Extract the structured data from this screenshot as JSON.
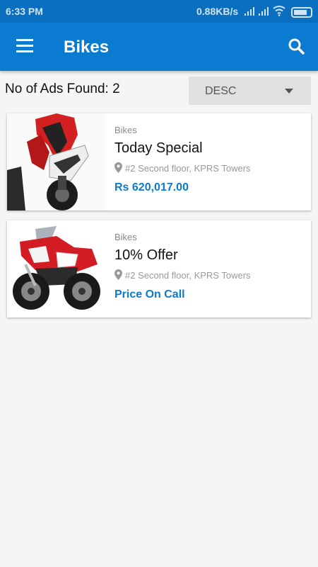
{
  "status_bar": {
    "time": "6:33 PM",
    "network_speed": "0.88KB/s"
  },
  "app_bar": {
    "title": "Bikes",
    "menu_icon": "hamburger-menu-icon",
    "search_icon": "search-icon"
  },
  "results": {
    "count_label": "No of Ads Found: 2"
  },
  "sort": {
    "selected": "DESC"
  },
  "ads": [
    {
      "category": "Bikes",
      "title": "Today Special",
      "location": "#2 Second floor, KPRS Towers",
      "price": "Rs 620,017.00"
    },
    {
      "category": "Bikes",
      "title": "10% Offer",
      "location": "#2 Second floor, KPRS Towers",
      "price": "Price On Call"
    }
  ],
  "colors": {
    "status_bar": "#0a6fbf",
    "app_bar": "#0a7bd0",
    "price": "#0a7bd0",
    "background": "#f5f5f5"
  }
}
